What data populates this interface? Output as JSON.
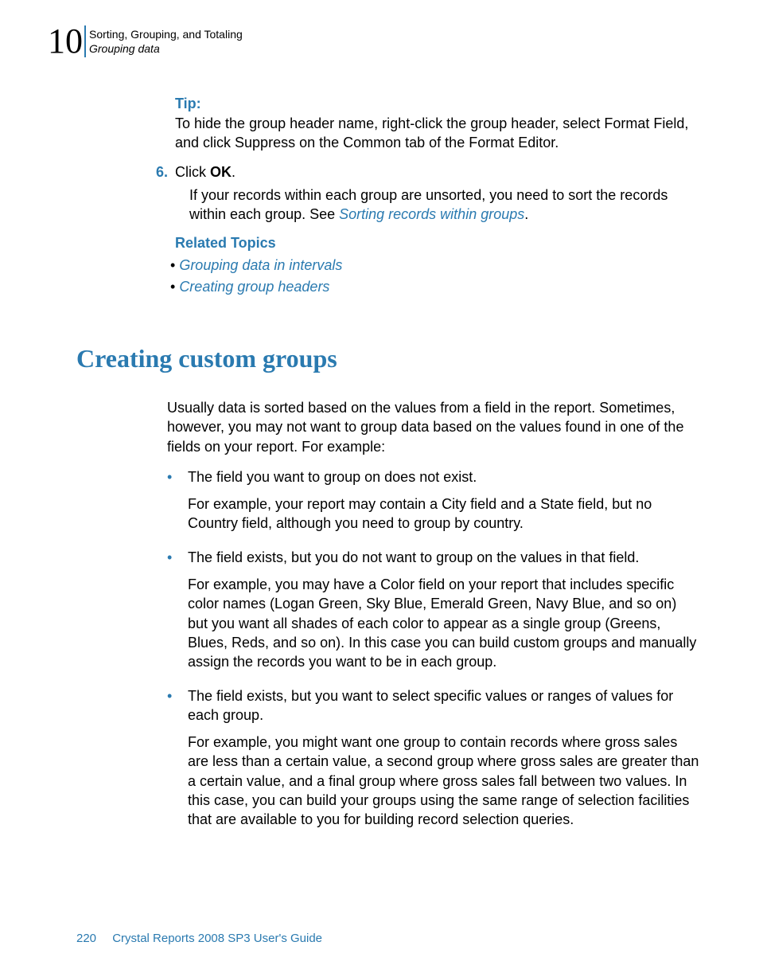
{
  "header": {
    "chapter_number": "10",
    "title": "Sorting, Grouping, and Totaling",
    "subtitle": "Grouping data"
  },
  "tip": {
    "label": "Tip:",
    "text": "To hide the group header name, right-click the group header, select Format Field, and click Suppress on the Common tab of the Format Editor."
  },
  "step": {
    "number": "6.",
    "prefix": "Click ",
    "bold": "OK",
    "suffix": "."
  },
  "step_followup": {
    "text_before_link": "If your records within each group are unsorted, you need to sort the records within each group. See ",
    "link": "Sorting records within groups",
    "after": "."
  },
  "related": {
    "label": "Related Topics",
    "items": [
      "Grouping data in intervals",
      "Creating group headers"
    ]
  },
  "section": {
    "heading": "Creating custom groups",
    "intro": "Usually data is sorted based on the values from a field in the report. Sometimes, however, you may not want to group data based on the values found in one of the fields on your report. For example:",
    "bullets": [
      {
        "lead": "The field you want to group on does not exist.",
        "explain": "For example, your report may contain a City field and a State field, but no Country field, although you need to group by country."
      },
      {
        "lead": "The field exists, but you do not want to group on the values in that field.",
        "explain": "For example, you may have a Color field on your report that includes specific color names (Logan Green, Sky Blue, Emerald Green, Navy Blue, and so on) but you want all shades of each color to appear as a single group (Greens, Blues, Reds, and so on). In this case you can build custom groups and manually assign the records you want to be in each group."
      },
      {
        "lead": "The field exists, but you want to select specific values or ranges of values for each group.",
        "explain": "For example, you might want one group to contain records where gross sales are less than a certain value, a second group where gross sales are greater than a certain value, and a final group where gross sales fall between two values. In this case, you can build your groups using the same range of selection facilities that are available to you for building record selection queries."
      }
    ]
  },
  "footer": {
    "page": "220",
    "text": "Crystal Reports 2008 SP3 User's Guide"
  }
}
